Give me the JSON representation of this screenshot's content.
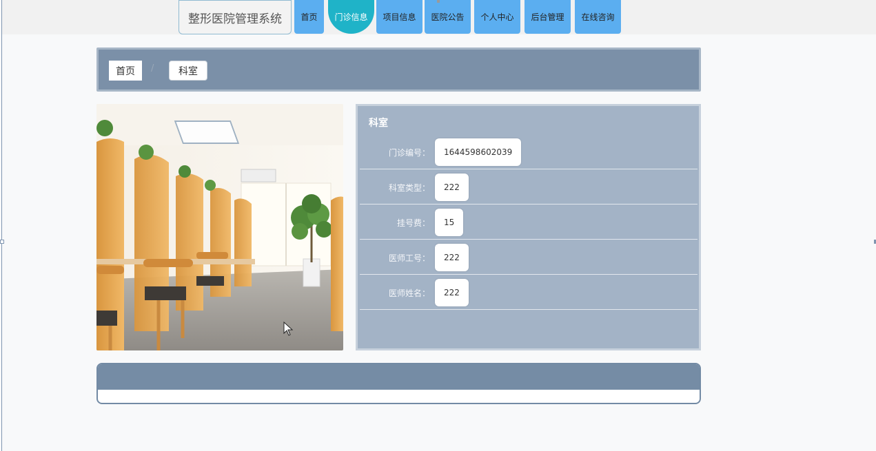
{
  "brand": {
    "title": "整形医院管理系统"
  },
  "nav": {
    "items": [
      {
        "label": "首页"
      },
      {
        "label": "门诊信息",
        "active": true
      },
      {
        "label": "项目信息"
      },
      {
        "label": "医院公告"
      },
      {
        "label": "个人中心"
      },
      {
        "label": "后台管理"
      },
      {
        "label": "在线咨询"
      }
    ]
  },
  "breadcrumb": {
    "home": "首页",
    "separator": "/",
    "current": "科室"
  },
  "detail": {
    "title": "科室",
    "fields": [
      {
        "label": "门诊编号：",
        "value": "1644598602039"
      },
      {
        "label": "科室类型：",
        "value": "222"
      },
      {
        "label": "挂号费：",
        "value": "15"
      },
      {
        "label": "医师工号：",
        "value": "222"
      },
      {
        "label": "医师姓名：",
        "value": "222"
      }
    ]
  },
  "colors": {
    "nav": "#5baef0",
    "nav_active": "#1fb3c8",
    "breadcrumb_bar": "#7b90a8",
    "detail_panel": "#a3b3c6",
    "bottom_header": "#758ca5"
  }
}
